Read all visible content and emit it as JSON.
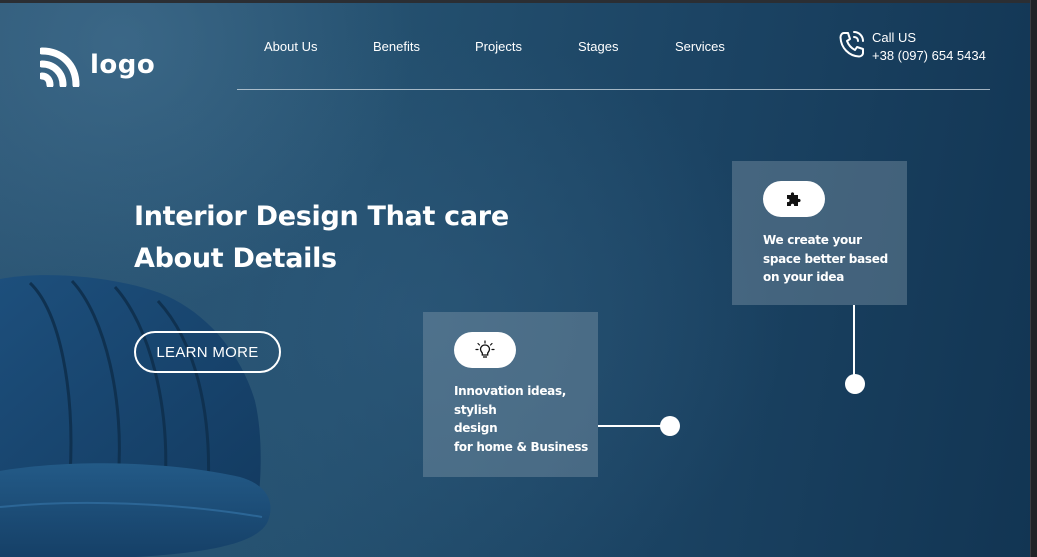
{
  "brand": {
    "logo_text": "logo"
  },
  "nav": {
    "items": [
      "About Us",
      "Benefits",
      "Projects",
      "Stages",
      "Services"
    ]
  },
  "contact": {
    "label": "Call US",
    "phone": "+38 (097) 654 5434",
    "icon": "phone-call-icon"
  },
  "hero": {
    "headline": [
      "Interior Design That care",
      "About Details"
    ],
    "cta_label": "LEARN MORE"
  },
  "cards": [
    {
      "icon": "puzzle-icon",
      "lines": [
        "We create your",
        "space better based",
        "on your idea"
      ]
    },
    {
      "icon": "lightbulb-icon",
      "lines": [
        "Innovation ideas,",
        "stylish",
        "design",
        "for home & Business"
      ]
    }
  ],
  "colors": {
    "background": "#1f4666",
    "text": "#ffffff",
    "card": "#8ca0b0"
  }
}
